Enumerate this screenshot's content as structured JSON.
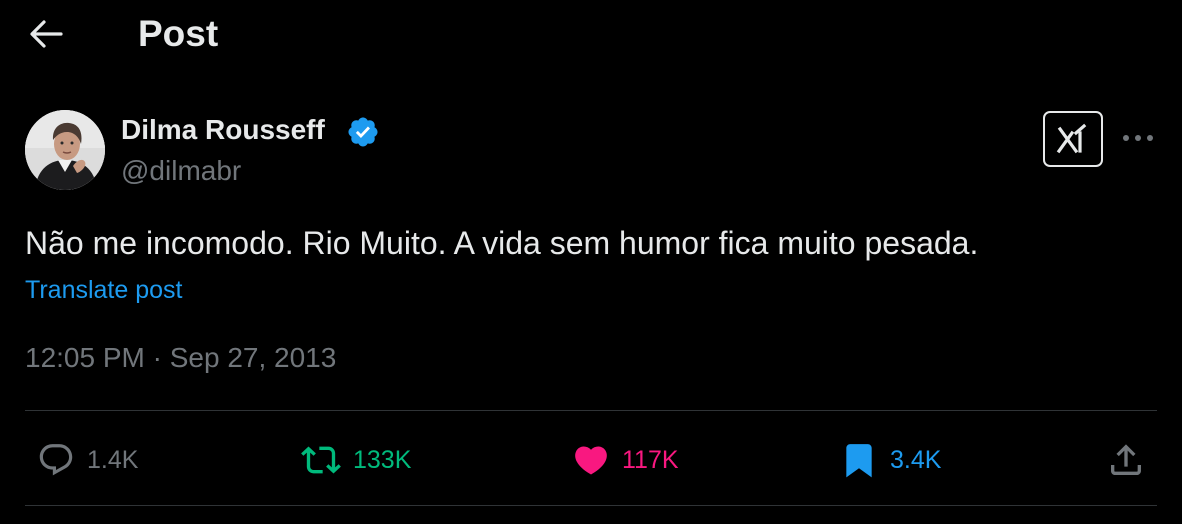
{
  "header": {
    "title": "Post",
    "back_icon": "arrow-left-icon"
  },
  "author": {
    "display_name": "Dilma Rousseff",
    "handle": "@dilmabr",
    "verified": true,
    "verified_color": "#1d9bf0"
  },
  "post": {
    "text": "Não me incomodo. Rio Muito. A vida sem humor fica muito pesada.",
    "translate_label": "Translate post",
    "timestamp": "12:05 PM · Sep 27, 2013"
  },
  "actions": {
    "replies": {
      "icon": "reply-icon",
      "count": "1.4K",
      "color": "#71767b"
    },
    "reposts": {
      "icon": "repost-icon",
      "count": "133K",
      "color": "#00ba7c"
    },
    "likes": {
      "icon": "heart-icon",
      "count": "117K",
      "color": "#f91880"
    },
    "bookmarks": {
      "icon": "bookmark-icon",
      "count": "3.4K",
      "color": "#1d9bf0"
    },
    "share": {
      "icon": "share-icon"
    }
  },
  "colors": {
    "background": "#000000",
    "text": "#e7e9ea",
    "secondary_text": "#71767b",
    "link": "#1d9bf0",
    "divider": "#2f3336"
  }
}
